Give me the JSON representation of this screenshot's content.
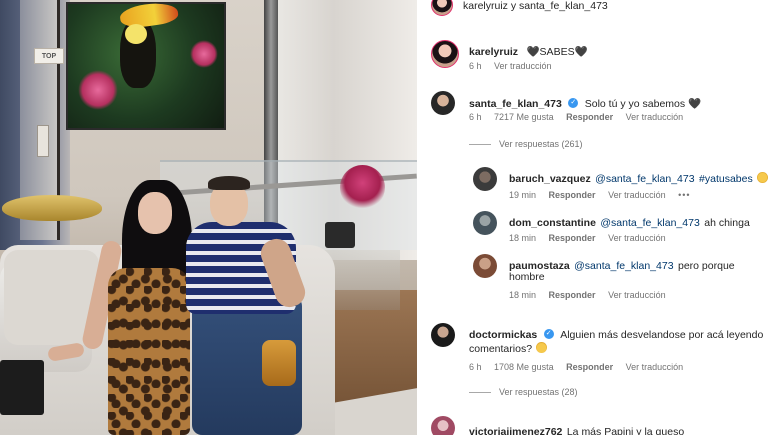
{
  "post": {
    "header_title": "karelyruiz y santa_fe_klan_473"
  },
  "caption": {
    "username": "karelyruiz",
    "text": "🖤SABES🖤",
    "time": "6 h",
    "translate": "Ver traducción"
  },
  "comments": [
    {
      "username": "santa_fe_klan_473",
      "verified": true,
      "text": "Solo tú y yo sabemos 🖤",
      "time": "6 h",
      "likes": "7217 Me gusta",
      "reply": "Responder",
      "translate": "Ver traducción",
      "view_replies": "Ver respuestas (261)",
      "replies": [
        {
          "username": "baruch_vazquez",
          "mention": "@santa_fe_klan_473",
          "tag": "#yatusabes",
          "time": "19 min",
          "reply": "Responder",
          "translate": "Ver traducción",
          "more": "•••"
        },
        {
          "username": "dom_constantine",
          "mention": "@santa_fe_klan_473",
          "text": "ah chinga",
          "time": "18 min",
          "reply": "Responder",
          "translate": "Ver traducción"
        },
        {
          "username": "paumostaza",
          "mention": "@santa_fe_klan_473",
          "text_line1": "pero porque",
          "text_line2": "hombre",
          "time": "18 min",
          "reply": "Responder",
          "translate": "Ver traducción"
        }
      ]
    },
    {
      "username": "doctormickas",
      "verified": true,
      "text_line1": "Alguien más desvelandose por acá leyendo",
      "text_line2": "comentarios?",
      "time": "6 h",
      "likes": "1708 Me gusta",
      "reply": "Responder",
      "translate": "Ver traducción",
      "view_replies": "Ver respuestas (28)"
    },
    {
      "username": "victoriajimenez762",
      "text": "La más Papini y la queso"
    }
  ],
  "photo": {
    "sign_text": "TOP"
  }
}
